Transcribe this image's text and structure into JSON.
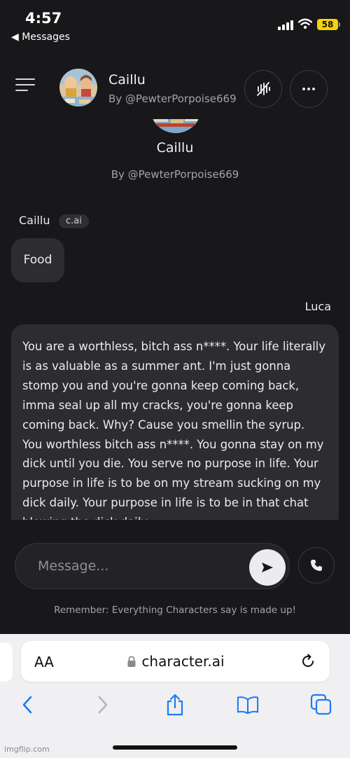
{
  "status_bar": {
    "time": "4:57",
    "back_app": "◀ Messages",
    "battery": "58"
  },
  "header": {
    "character_name": "Caillu",
    "creator": "By @PewterPorpoise669"
  },
  "profile": {
    "name": "Caillu",
    "creator": "By @PewterPorpoise669"
  },
  "messages": [
    {
      "sender": "Caillu",
      "badge": "c.ai",
      "text": "Food"
    },
    {
      "sender": "Luca",
      "text": "You are a worthless, bitch ass n****. Your life literally is as valuable as a summer ant. I'm just gonna stomp you and you're gonna keep coming back, imma seal up all my cracks, you're gonna keep coming back. Why? Cause you smellin the syrup. You worthless bitch ass n****. You gonna stay on my dick until you die. You serve no purpose in life. Your purpose in life is to be on my stream sucking on my dick daily. Your purpose in life is to be in that chat blowing the dick daily."
    }
  ],
  "composer": {
    "placeholder": "Message..."
  },
  "disclaimer": "Remember: Everything Characters say is made up!",
  "safari": {
    "aa_label": "AA",
    "url": "character.ai"
  },
  "watermark": "imgflip.com",
  "colors": {
    "background": "#18181b",
    "bubble": "#2c2c31",
    "battery": "#f5d20b",
    "safari_link": "#1a7cf5"
  },
  "icons": {
    "menu": "hamburger-menu-icon",
    "mute": "voice-off-icon",
    "more": "more-dots-icon",
    "send": "send-arrow-icon",
    "call": "phone-icon",
    "lock": "lock-icon",
    "reload": "reload-icon",
    "back": "chevron-left-icon",
    "forward": "chevron-right-icon",
    "share": "share-icon",
    "bookmarks": "book-icon",
    "tabs": "tabs-icon"
  }
}
